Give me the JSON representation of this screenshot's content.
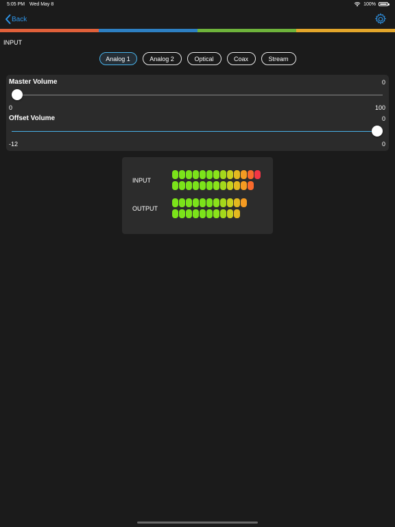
{
  "status": {
    "time": "5:05 PM",
    "date": "Wed May 8",
    "battery": "100%"
  },
  "nav": {
    "back_label": "Back"
  },
  "color_bar": [
    "#e0603a",
    "#2d7fc2",
    "#6eb33b",
    "#e3a62b"
  ],
  "input_section": {
    "title": "INPUT",
    "tabs": [
      "Analog 1",
      "Analog 2",
      "Optical",
      "Coax",
      "Stream"
    ],
    "selected": "Analog 1"
  },
  "master_volume": {
    "label": "Master Volume",
    "value": "0",
    "min": "0",
    "max": "100",
    "level": 0.0
  },
  "offset_volume": {
    "label": "Offset  Volume",
    "value": "0",
    "min": "-12",
    "max": "0",
    "level": 1.0
  },
  "meter": {
    "input_label": "INPUT",
    "output_label": "OUTPUT",
    "input_levels": [
      13,
      12
    ],
    "output_levels": [
      11,
      10
    ]
  },
  "colors": {
    "accent": "#2f95e8",
    "active_tab_border": "#49b3ea",
    "track_fill": "#49b3ea"
  }
}
